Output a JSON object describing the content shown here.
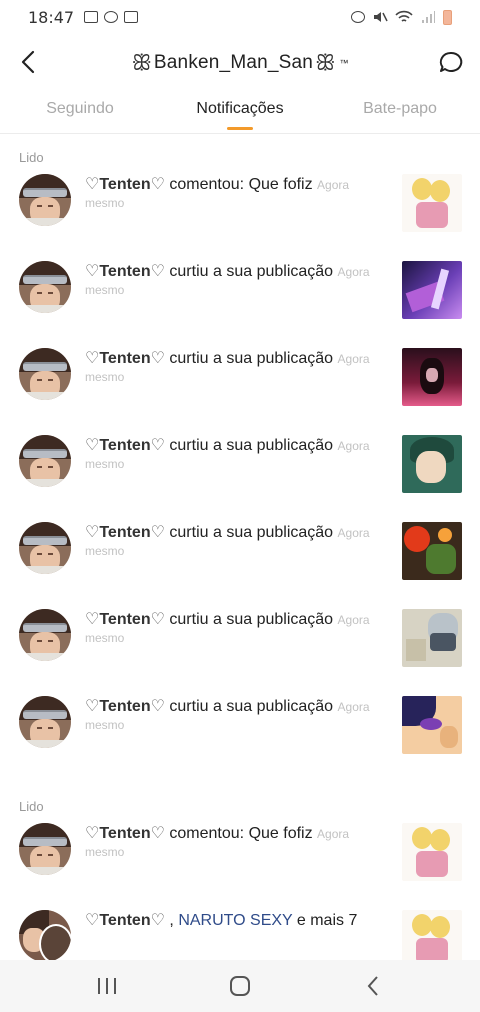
{
  "status_bar": {
    "time": "18:47"
  },
  "header": {
    "title": "Banken_Man_San",
    "title_mark": "™"
  },
  "tabs": [
    {
      "label": "Seguindo",
      "active": false
    },
    {
      "label": "Notificações",
      "active": true
    },
    {
      "label": "Bate-papo",
      "active": false
    }
  ],
  "sections": [
    {
      "label": "Lido",
      "notifications": [
        {
          "user": "Tenten",
          "action": "comentou: Que fofiz",
          "time": "Agora mesmo",
          "thumb": "blonde-couple"
        },
        {
          "user": "Tenten",
          "action": "curtiu a sua publicação",
          "time": "Agora mesmo",
          "thumb": "purple-lightning"
        },
        {
          "user": "Tenten",
          "action": "curtiu a sua publicação",
          "time": "Agora mesmo",
          "thumb": "dark-red-portrait"
        },
        {
          "user": "Tenten",
          "action": "curtiu a sua publicação",
          "time": "Agora mesmo",
          "thumb": "green-hair-girl"
        },
        {
          "user": "Tenten",
          "action": "curtiu a sua publicação",
          "time": "Agora mesmo",
          "thumb": "red-fire-battle"
        },
        {
          "user": "Tenten",
          "action": "curtiu a sua publicação",
          "time": "Agora mesmo",
          "thumb": "masked-ninja"
        },
        {
          "user": "Tenten",
          "action": "curtiu a sua publicação",
          "time": "Agora mesmo",
          "thumb": "purple-eye"
        }
      ]
    },
    {
      "label": "Lido",
      "notifications": [
        {
          "user": "Tenten",
          "action": "comentou: Que fofiz",
          "time": "Agora mesmo",
          "thumb": "blonde-couple"
        }
      ]
    }
  ],
  "partial_notification": {
    "user": "Tenten",
    "connector": ",",
    "other_user": "NARUTO SEXY",
    "rest": "e mais 7"
  },
  "colors": {
    "accent": "#f39a2a",
    "link": "#2f4b89",
    "muted": "#c2c2c2"
  }
}
